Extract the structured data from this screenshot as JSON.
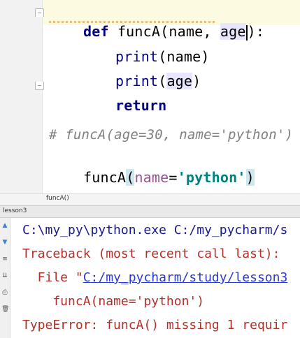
{
  "editor": {
    "lines": {
      "def_kw": "def",
      "def_rest_a": " funcA(",
      "def_param_name": "name",
      "def_sep": ", ",
      "def_param_age_a": "age",
      "def_close": "):",
      "print1_kw": "print",
      "print1_arg": "(name)",
      "print2_kw": "print",
      "print2_open": "(",
      "print2_arg": "age",
      "print2_close": ")",
      "return_kw": "return",
      "comment": "# funcA(age=30, name='python')",
      "call_name": "funcA",
      "call_open": "(",
      "call_param": "name",
      "call_eq": "=",
      "call_str": "'python'",
      "call_close": ")"
    }
  },
  "breadcrumb": "funcA()",
  "run_tab": "lesson3",
  "console": {
    "line1": "C:\\my_py\\python.exe C:/my_pycharm/s",
    "line2": "Traceback (most recent call last):",
    "line3_prefix": "  File \"",
    "line3_link": "C:/my_pycharm/study/lesson3",
    "line4": "    funcA(name='python')",
    "line5": "TypeError: funcA() missing 1 requir"
  },
  "colors": {
    "keyword": "#000080",
    "string": "#008080",
    "comment": "#808080",
    "error": "#b2302a"
  }
}
